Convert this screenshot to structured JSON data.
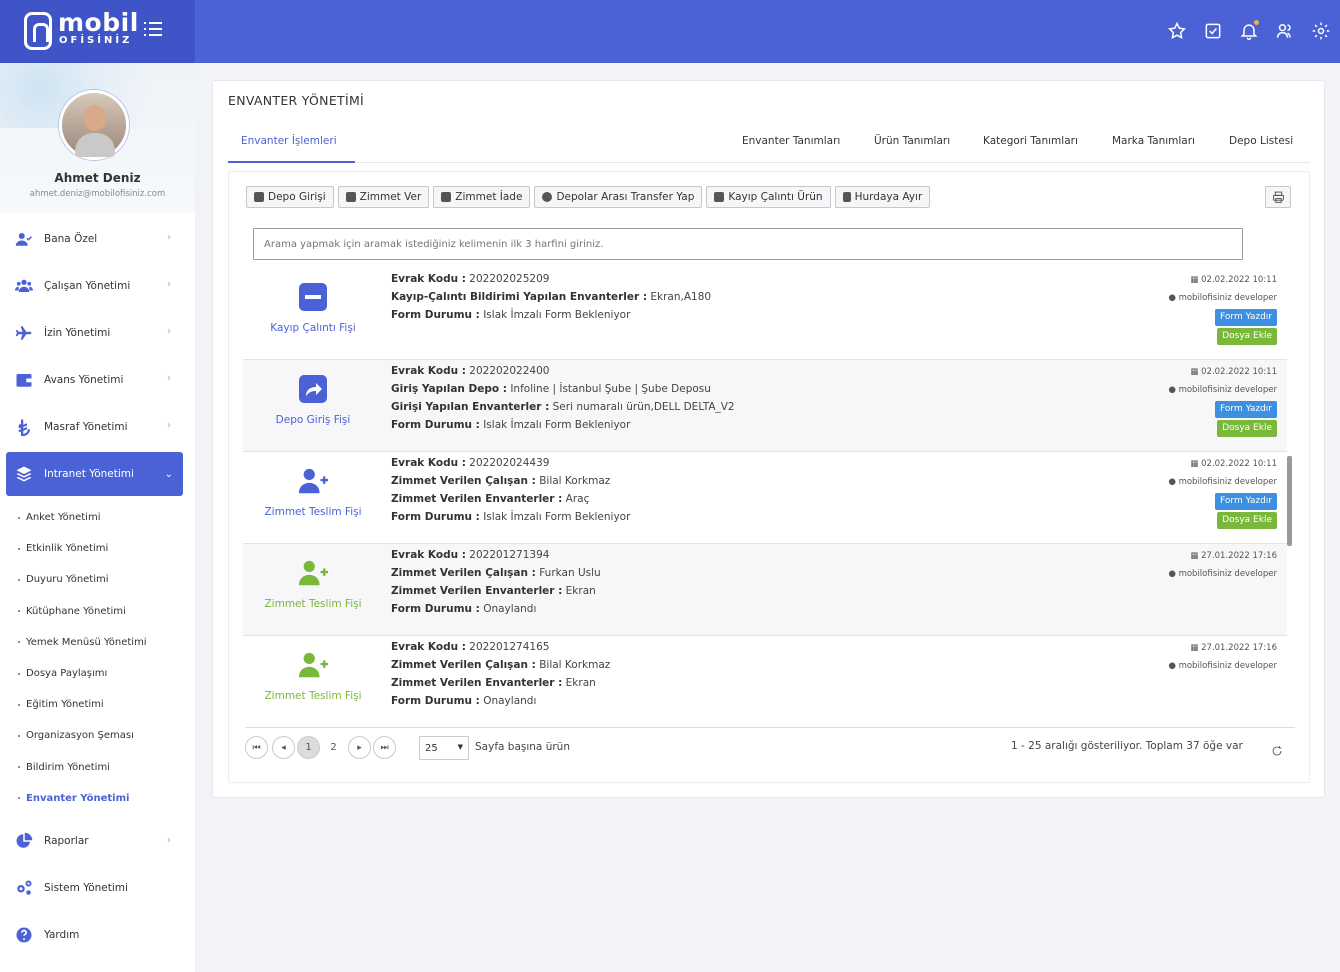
{
  "brand": {
    "name": "mobil",
    "sub": "OFİSİNİZ"
  },
  "colors": {
    "primary": "#4b62d6",
    "blue_button": "#3d8fe0",
    "green_button": "#79b83a",
    "green_icon": "#79b83a"
  },
  "header": {
    "icons": [
      "star-icon",
      "check-square-icon",
      "bell-icon",
      "users-icon",
      "gear-icon"
    ]
  },
  "profile": {
    "name": "Ahmet Deniz",
    "email": "ahmet.deniz@mobilofisiniz.com"
  },
  "nav": {
    "items": [
      {
        "label": "Bana Özel",
        "icon": "user-check-icon"
      },
      {
        "label": "Çalışan Yönetimi",
        "icon": "users-icon"
      },
      {
        "label": "İzin Yönetimi",
        "icon": "plane-icon"
      },
      {
        "label": "Avans Yönetimi",
        "icon": "wallet-icon"
      },
      {
        "label": "Masraf Yönetimi",
        "icon": "lira-icon"
      },
      {
        "label": "Intranet Yönetimi",
        "icon": "layers-icon"
      }
    ],
    "sub_items": [
      "Anket Yönetimi",
      "Etkinlik Yönetimi",
      "Duyuru Yönetimi",
      "Kütüphane Yönetimi",
      "Yemek Menüsü Yönetimi",
      "Dosya Paylaşımı",
      "Eğitim Yönetimi",
      "Organizasyon Şeması",
      "Bildirim Yönetimi",
      "Envanter Yönetimi"
    ],
    "bottom_items": [
      {
        "label": "Raporlar",
        "icon": "pie-chart-icon"
      },
      {
        "label": "Sistem Yönetimi",
        "icon": "cogs-icon"
      },
      {
        "label": "Yardım",
        "icon": "question-icon"
      }
    ]
  },
  "page": {
    "title": "ENVANTER YÖNETİMİ"
  },
  "tabs": [
    "Envanter İşlemleri",
    "Envanter Tanımları",
    "Ürün Tanımları",
    "Kategori Tanımları",
    "Marka Tanımları",
    "Depo Listesi"
  ],
  "toolbar": [
    "Depo Girişi",
    "Zimmet Ver",
    "Zimmet İade",
    "Depolar Arası Transfer Yap",
    "Kayıp Çalıntı Ürün",
    "Hurdaya Ayır"
  ],
  "search": {
    "placeholder": "Arama yapmak için aramak istediğiniz kelimenin ilk 3 harfini giriniz."
  },
  "records": [
    {
      "type": "Kayıp Çalıntı Fişi",
      "lines": [
        [
          "Evrak Kodu :",
          "202202025209"
        ],
        [
          "Kayıp-Çalıntı Bildirimi Yapılan Envanterler :",
          "Ekran,A180"
        ],
        [
          "Form Durumu :",
          "Islak İmzalı Form Bekleniyor"
        ]
      ],
      "date": "02.02.2022 10:11",
      "user": "mobilofisiniz developer",
      "print": "Form Yazdır",
      "attach": "Dosya Ekle"
    },
    {
      "type": "Depo Giriş Fişi",
      "lines": [
        [
          "Evrak Kodu :",
          "202202022400"
        ],
        [
          "Giriş Yapılan Depo :",
          "Infoline | İstanbul Şube | Şube Deposu"
        ],
        [
          "Girişi Yapılan Envanterler :",
          "Seri numaralı ürün,DELL DELTA_V2"
        ],
        [
          "Form Durumu :",
          "Islak İmzalı Form Bekleniyor"
        ]
      ],
      "date": "02.02.2022 10:11",
      "user": "mobilofisiniz developer",
      "print": "Form Yazdır",
      "attach": "Dosya Ekle"
    },
    {
      "type": "Zimmet Teslim Fişi",
      "lines": [
        [
          "Evrak Kodu :",
          "202202024439"
        ],
        [
          "Zimmet Verilen Çalışan :",
          "Bilal Korkmaz"
        ],
        [
          "Zimmet Verilen Envanterler :",
          "Araç"
        ],
        [
          "Form Durumu :",
          "Islak İmzalı Form Bekleniyor"
        ]
      ],
      "date": "02.02.2022 10:11",
      "user": "mobilofisiniz developer",
      "print": "Form Yazdır",
      "attach": "Dosya Ekle"
    },
    {
      "type": "Zimmet Teslim Fişi",
      "lines": [
        [
          "Evrak Kodu :",
          "202201271394"
        ],
        [
          "Zimmet Verilen Çalışan :",
          "Furkan Uslu"
        ],
        [
          "Zimmet Verilen Envanterler :",
          "Ekran"
        ],
        [
          "Form Durumu :",
          "Onaylandı"
        ]
      ],
      "date": "27.01.2022 17:16",
      "user": "mobilofisiniz developer"
    },
    {
      "type": "Zimmet Teslim Fişi",
      "lines": [
        [
          "Evrak Kodu :",
          "202201274165"
        ],
        [
          "Zimmet Verilen Çalışan :",
          "Bilal Korkmaz"
        ],
        [
          "Zimmet Verilen Envanterler :",
          "Ekran"
        ],
        [
          "Form Durumu :",
          "Onaylandı"
        ]
      ],
      "date": "27.01.2022 17:16",
      "user": "mobilofisiniz developer"
    }
  ],
  "pagination": {
    "pages": [
      "1",
      "2"
    ],
    "current": "1",
    "page_size": "25",
    "page_size_label": "Sayfa başına ürün",
    "info": "1 - 25 aralığı gösteriliyor. Toplam 37 öğe var"
  }
}
